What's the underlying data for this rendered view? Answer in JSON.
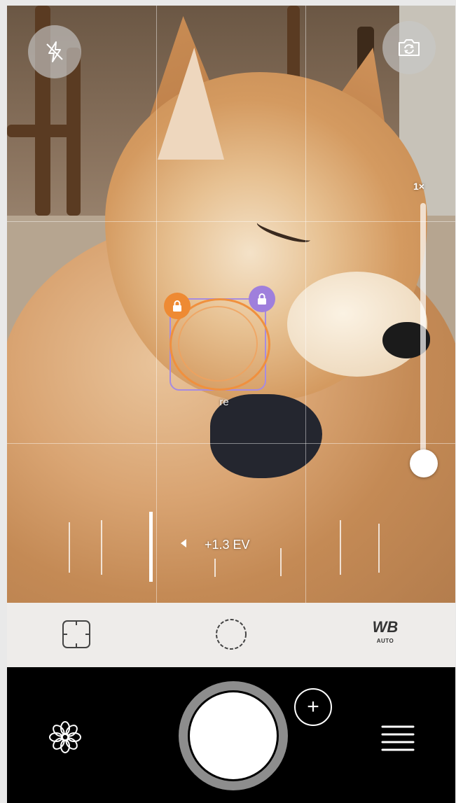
{
  "viewfinder": {
    "zoom_label": "1×",
    "zoom_level": 0.0,
    "focus_caption": "re",
    "exposure_label": "+1.3 EV"
  },
  "top_controls": {
    "flash_icon": "flash-off-icon",
    "switch_camera_icon": "switch-camera-icon"
  },
  "mode_bar": {
    "focus_mode_icon": "focus-frame-icon",
    "exposure_mode_icon": "exposure-dial-icon",
    "wb_label": "WB",
    "wb_sub_label": "AUTO"
  },
  "bottom_bar": {
    "settings_icon": "flower-settings-icon",
    "shutter_icon": "shutter-icon",
    "plus_label": "+",
    "menu_icon": "menu-icon"
  },
  "colors": {
    "focus_lock": "#ee8a33",
    "exposure_lock": "#9f7fdc",
    "mode_bar_bg": "#eeecea",
    "bottom_bar_bg": "#000000"
  }
}
